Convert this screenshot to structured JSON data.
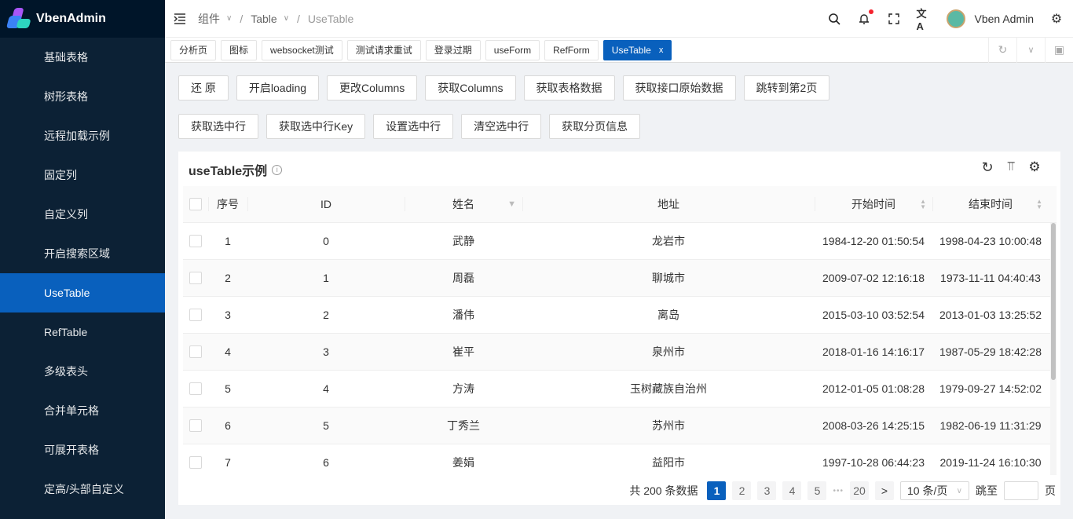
{
  "app": {
    "name": "VbenAdmin"
  },
  "sidebar": {
    "items": [
      {
        "label": "基础表格"
      },
      {
        "label": "树形表格"
      },
      {
        "label": "远程加载示例"
      },
      {
        "label": "固定列"
      },
      {
        "label": "自定义列"
      },
      {
        "label": "开启搜索区域"
      },
      {
        "label": "UseTable",
        "active": true
      },
      {
        "label": "RefTable"
      },
      {
        "label": "多级表头"
      },
      {
        "label": "合并单元格"
      },
      {
        "label": "可展开表格"
      },
      {
        "label": "定高/头部自定义"
      }
    ]
  },
  "header": {
    "breadcrumb": [
      "组件",
      "Table",
      "UseTable"
    ],
    "user": "Vben Admin",
    "accent": "#0960bd"
  },
  "tabs": [
    {
      "label": "分析页"
    },
    {
      "label": "图标"
    },
    {
      "label": "websocket测试"
    },
    {
      "label": "测试请求重试"
    },
    {
      "label": "登录过期"
    },
    {
      "label": "useForm"
    },
    {
      "label": "RefForm"
    },
    {
      "label": "UseTable",
      "active": true,
      "close": "x"
    }
  ],
  "buttons_row1": [
    "还 原",
    "开启loading",
    "更改Columns",
    "获取Columns",
    "获取表格数据",
    "获取接口原始数据",
    "跳转到第2页"
  ],
  "buttons_row2": [
    "获取选中行",
    "获取选中行Key",
    "设置选中行",
    "清空选中行",
    "获取分页信息"
  ],
  "table": {
    "title": "useTable示例",
    "columns": [
      "序号",
      "ID",
      "姓名",
      "地址",
      "开始时间",
      "结束时间"
    ],
    "rows": [
      [
        "1",
        "0",
        "武静",
        "龙岩市",
        "1984-12-20 01:50:54",
        "1998-04-23 10:00:48"
      ],
      [
        "2",
        "1",
        "周磊",
        "聊城市",
        "2009-07-02 12:16:18",
        "1973-11-11 04:40:43"
      ],
      [
        "3",
        "2",
        "潘伟",
        "离岛",
        "2015-03-10 03:52:54",
        "2013-01-03 13:25:52"
      ],
      [
        "4",
        "3",
        "崔平",
        "泉州市",
        "2018-01-16 14:16:17",
        "1987-05-29 18:42:28"
      ],
      [
        "5",
        "4",
        "方涛",
        "玉树藏族自治州",
        "2012-01-05 01:08:28",
        "1979-09-27 14:52:02"
      ],
      [
        "6",
        "5",
        "丁秀兰",
        "苏州市",
        "2008-03-26 14:25:15",
        "1982-06-19 11:31:29"
      ],
      [
        "7",
        "6",
        "姜娟",
        "益阳市",
        "1997-10-28 06:44:23",
        "2019-11-24 16:10:30"
      ]
    ]
  },
  "pagination": {
    "total_text": "共 200 条数据",
    "pages": [
      "1",
      "2",
      "3",
      "4",
      "5"
    ],
    "ellipsis": "•••",
    "last": "20",
    "current": "1",
    "next": ">",
    "page_size": "10 条/页",
    "jump_label": "跳至",
    "jump_value": "",
    "page_suffix": "页"
  }
}
